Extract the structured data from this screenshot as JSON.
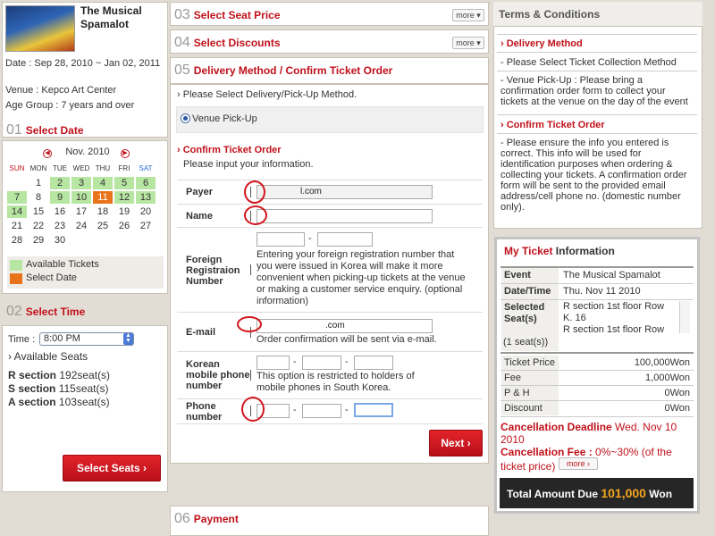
{
  "show": {
    "title": "The Musical Spamalot",
    "date": "Date : Sep 28, 2010 ~ Jan 02, 2011",
    "venue": "Venue : Kepco Art Center",
    "age_group": "Age Group : 7 years and over"
  },
  "steps": {
    "s01": {
      "num": "01",
      "title": "Select Date"
    },
    "s02": {
      "num": "02",
      "title": "Select Time"
    },
    "s03": {
      "num": "03",
      "title": "Select Seat Price",
      "more": "more"
    },
    "s04": {
      "num": "04",
      "title": "Select Discounts",
      "more": "more"
    },
    "s05": {
      "num": "05",
      "title": "Delivery Method / Confirm Ticket Order"
    },
    "s06": {
      "num": "06",
      "title": "Payment"
    }
  },
  "calendar": {
    "month": "Nov. 2010",
    "dow": [
      "SUN",
      "MON",
      "TUE",
      "WED",
      "THU",
      "FRI",
      "SAT"
    ],
    "legend_available": "Available Tickets",
    "legend_selected": "Select Date",
    "colors": {
      "available": "#b7e5a2",
      "selected": "#e8731a"
    }
  },
  "time": {
    "label": "Time :",
    "value": "8:00 PM",
    "available_seats": "Available Seats",
    "sections": [
      {
        "name": "R section",
        "seats": "192seat(s)"
      },
      {
        "name": "S section",
        "seats": "115seat(s)"
      },
      {
        "name": "A section",
        "seats": "103seat(s)"
      }
    ],
    "button": "Select Seats"
  },
  "delivery": {
    "prompt": "Please Select Delivery/Pick-Up Method.",
    "option": "Venue Pick-Up"
  },
  "confirm": {
    "title": "Confirm Ticket Order",
    "subtitle": "Please input your information.",
    "payer_label": "Payer",
    "payer_value": "l.com",
    "name_label": "Name",
    "foreign_label": "Foreign Registraion Number",
    "foreign_help": "Entering your foreign registration number that you were issued in Korea will make it more convenient when picking-up tickets at the venue or making a customer service enquiry. (optional information)",
    "email_label": "E-mail",
    "email_value": ".com",
    "email_help": "Order confirmation will be sent via e-mail.",
    "mobile_label": "Korean mobile phone number",
    "mobile_help": "This option is restricted to holders of mobile phones in South Korea.",
    "phone_label": "Phone number",
    "dash": "-",
    "next": "Next"
  },
  "terms": {
    "title": "Terms & Conditions",
    "delivery_title": "Delivery Method",
    "delivery_items": [
      "- Please Select Ticket Collection Method",
      "- Venue Pick-Up : Please bring a confirmation order form to collect your tickets at the venue on the day of the event"
    ],
    "confirm_title": "Confirm Ticket Order",
    "confirm_items": [
      "- Please ensure the info you entered is correct. This info will be used for identification purposes when ordering & collecting your tickets. A confirmation order form will be sent to the provided email address/cell phone no. (domestic number only)."
    ]
  },
  "my_ticket": {
    "title_my": "My Ticket",
    "title_rest": " Information",
    "event_label": "Event",
    "event_value": "The Musical Spamalot",
    "datetime_label": "Date/Time",
    "datetime_value": "Thu. Nov 11 2010",
    "seats_label": "Selected Seat(s)",
    "seats_count": "(1 seat(s))",
    "seats_value": "R section 1st floor Row K. 16",
    "seats_value2": "R section 1st floor Row",
    "price_label": "Ticket Price",
    "price_value": "100,000Won",
    "fee_label": "Fee",
    "fee_value": "1,000Won",
    "ph_label": "P & H",
    "ph_value": "0Won",
    "discount_label": "Discount",
    "discount_value": "0Won",
    "deadline_label": "Cancellation Deadline",
    "deadline_value": "Wed. Nov 10 2010",
    "cfee_label": "Cancellation Fee :",
    "cfee_value": "0%~30% (of the ticket price)",
    "more": "more",
    "total_label": "Total Amount Due",
    "total_value": "101,000",
    "total_unit": "Won"
  }
}
